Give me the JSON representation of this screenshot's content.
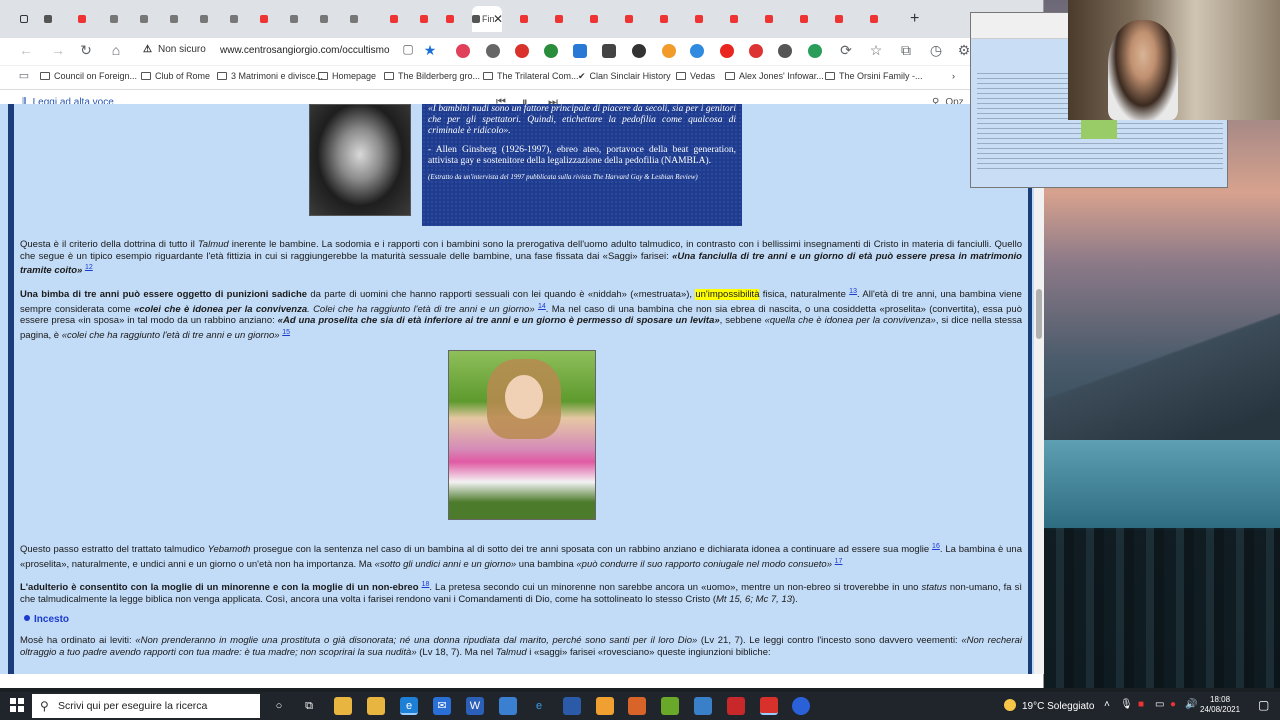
{
  "browser": {
    "active_tab_label": "Fin",
    "security_label": "Non sicuro",
    "url": "www.centrosangiorgio.com/occultismo...",
    "bookmarks": [
      "Council on Foreign...",
      "Club of Rome",
      "3 Matrimoni e divisce...",
      "Homepage",
      "The Bilderberg gro...",
      "The Trilateral Com...",
      "Clan Sinclair History",
      "Vedas",
      "Alex Jones' Infowar...",
      "The Orsini Family -..."
    ],
    "read_aloud_label": "Leggi ad alta voce",
    "options_label": "Opz"
  },
  "quote": {
    "text": "«I bambini nudi sono un fattore principale di piacere da secoli, sia per i genitori che per gli spettatori. Quindi, etichettare la pedofilia come qualcosa di criminale è ridicolo».",
    "attribution": "- Allen Ginsberg (1926-1997), ebreo ateo, portavoce della beat generation, attivista gay e sostenitore della legalizzazione della pedofilia (NAMBLA).",
    "source": "(Estratto da un'intervista del 1997 pubblicata sulla rivista The Harvard Gay & Lesbian Review)"
  },
  "article": {
    "p1_a": "Questa è il criterio della dottrina di tutto il ",
    "p1_talmud": "Talmud",
    "p1_b": " inerente le bambine. La sodomia e i rapporti con i bambini sono la prerogativa dell'uomo adulto talmudico, in contrasto con i bellissimi insegnamenti di Cristo in materia di fanciulli. Quello che segue è un tipico esempio riguardante l'età fittizia in cui si raggiungerebbe la maturità sessuale delle bambine, una fase fissata dai «Saggi» farisei: ",
    "p1_quote": "«Una fanciulla di tre anni e un giorno di età può essere presa in matrimonio tramite coito»",
    "p1_ref": "12",
    "p2_bold": "Una bimba di tre anni può essere oggetto di punizioni sadiche",
    "p2_a": " da parte di uomini che hanno rapporti sessuali con lei quando è «niddah» («mestruata»), ",
    "p2_hl": "un'impossibilità",
    "p2_b": " fisica, naturalmente ",
    "p2_ref1": "13",
    "p2_c": ". All'età di tre anni, una bambina viene sempre considerata come ",
    "p2_q1": "«colei che è idonea per la convivenza",
    "p2_q2": ". Colei che ha raggiunto l'età di tre anni e un giorno»",
    "p2_ref2": "14",
    "p2_d": ". Ma nel caso di una bambina che non sia ebrea di nascita, o una cosiddetta «proselita» (convertita), essa può essere presa «in sposa» in tal modo da un rabbino anziano: ",
    "p2_q3": "«Ad una proselita che sia di età inferiore ai tre anni e un giorno è permesso di sposare un levita»",
    "p2_e": ", sebbene ",
    "p2_q4": "«quella che è idonea per la convivenza»",
    "p2_f": ", si dice nella stessa pagina, è ",
    "p2_q5": "«colei che ha raggiunto l'età di tre anni e un giorno»",
    "p2_ref3": "15",
    "p3_a": "Questo passo estratto del trattato talmudico ",
    "p3_yeb": "Yebamoth",
    "p3_b": " prosegue con la sentenza nel caso di un bambina al di sotto dei tre anni sposata con un rabbino anziano e dichiarata idonea a continuare ad essere sua moglie ",
    "p3_ref1": "16",
    "p3_c": ". La bambina è una «proselita», naturalmente, e undici anni e un giorno o un'età non ha importanza. Ma ",
    "p3_q1": "«sotto gli undici anni e un giorno»",
    "p3_d": " una bambina ",
    "p3_q2": "«può condurre il suo rapporto coniugale nel modo consueto»",
    "p3_ref2": "17",
    "p4_bold": "L'adulterio è consentito con la moglie di un minorenne e con la moglie di un non-ebreo",
    "p4_ref": "18",
    "p4_a": ". La pretesa secondo cui un minorenne non sarebbe ancora un «uomo», mentre un non-ebreo si troverebbe in uno ",
    "p4_status": "status",
    "p4_b": " non-umano, fa sì che talmudicalmente la legge biblica non venga applicata. Così, ancora una volta i farisei rendono vani i Comandamenti di Dio, come ha sottolineato lo stesso Cristo (",
    "p4_refs": "Mt 15, 6; Mc 7, 13",
    "p4_c": ").",
    "section": "Incesto",
    "p5_a": "Mosè ha ordinato ai leviti: ",
    "p5_q1": "«Non prenderanno in moglie una prostituta o già disonorata; né una donna ripudiata dal marito, perché sono santi per il loro Dio»",
    "p5_b": " (Lv 21, 7). Le leggi contro l'incesto sono davvero veementi: ",
    "p5_q2": "«Non recherai oltraggio a tuo padre avendo rapporti con tua madre: è tua madre; non scoprirai la sua nudità»",
    "p5_c": " (Lv 18, 7). Ma nel ",
    "p5_talmud": "Talmud",
    "p5_d": " i «saggi» farisei «rovesciano» queste ingiunzioni bibliche:"
  },
  "taskbar": {
    "search_placeholder": "Scrivi qui per eseguire la ricerca",
    "weather": "19°C Soleggiato",
    "time": "18:08",
    "date": "24/08/2021"
  },
  "colors": {
    "page_bg": "#c2dbf6",
    "link": "#1a3bd0",
    "highlight": "#ffff00",
    "quote_bg": "#1f3c8f"
  }
}
